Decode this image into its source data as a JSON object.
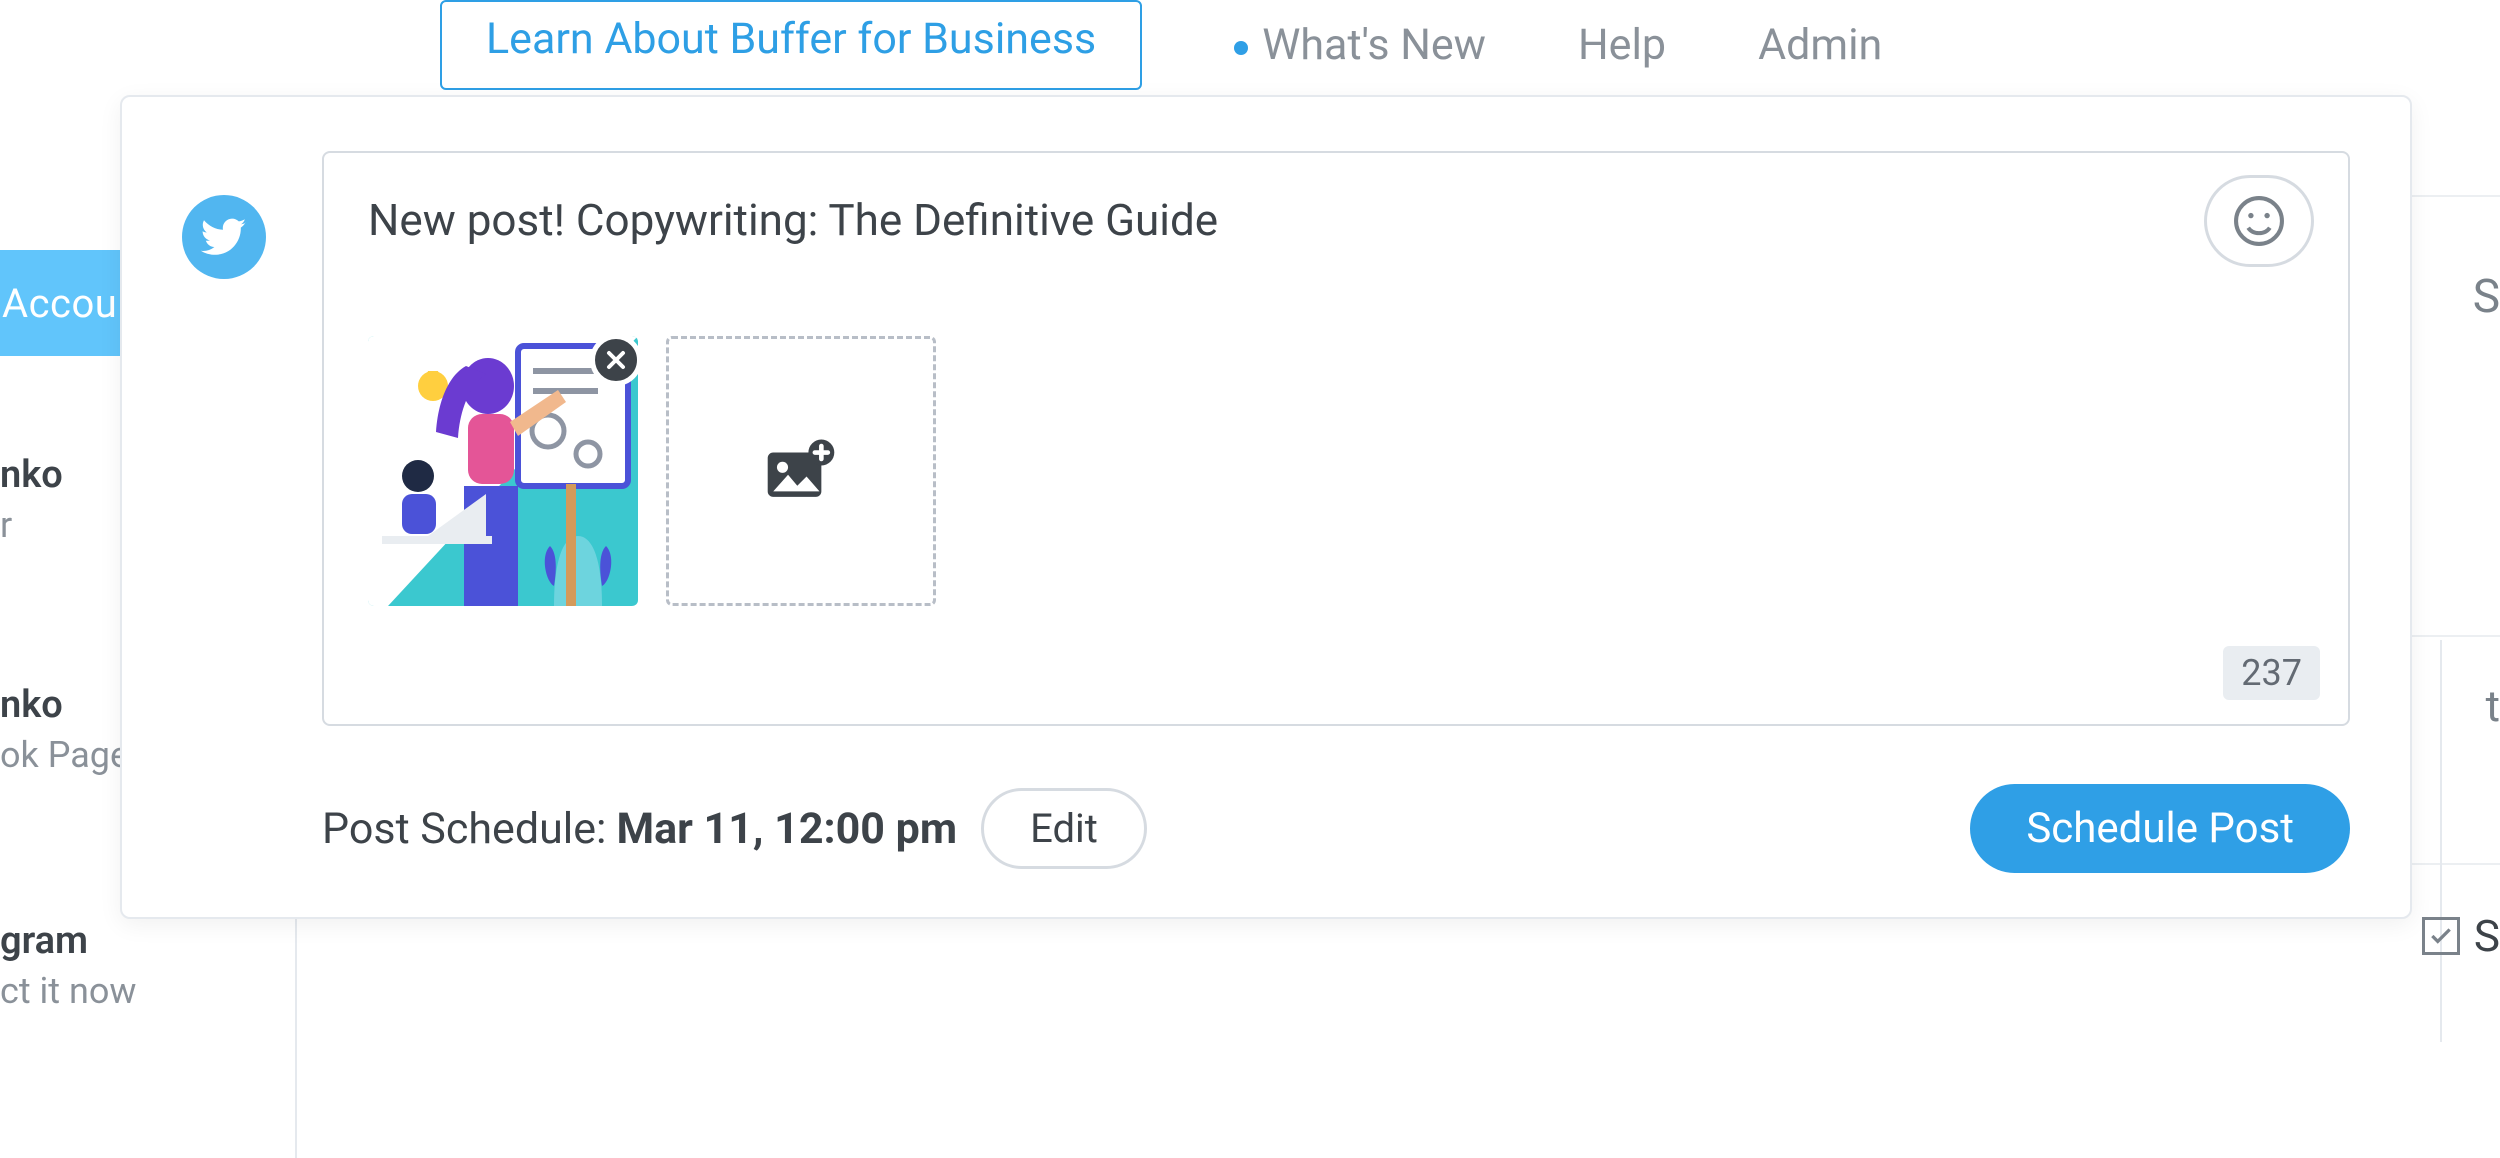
{
  "nav": {
    "business": "Learn About Buffer for Business",
    "whats_new": "What's New",
    "help": "Help",
    "admin": "Admin"
  },
  "sidebar": {
    "accounts_btn": "Accounts",
    "item1_title": "nko",
    "item1_sub": "r",
    "item2_title": "nko",
    "item2_sub": "ok Page",
    "item3_title": "gram",
    "item3_sub": "ct it now"
  },
  "modal": {
    "network": "twitter",
    "post_text": "New post! Copywriting: The Definitive Guide",
    "char_count": "237",
    "schedule_label": "Post Schedule:",
    "schedule_date": "Mar 11, 12:00 pm",
    "edit": "Edit",
    "schedule_btn": "Schedule Post",
    "emoji_icon": "smile-icon",
    "remove_icon": "close-icon",
    "add_image_icon": "image-add-icon"
  },
  "edge": {
    "t": "t",
    "s_top": "S",
    "s_bottom": "S"
  }
}
